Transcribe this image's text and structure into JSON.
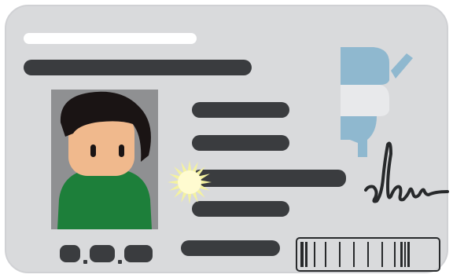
{
  "image": {
    "subject": "id-card-illustration"
  },
  "colors": {
    "card": "#d9dadc",
    "card_border": "#d0d1d4",
    "white_bar": "#ffffff",
    "dark_bar": "#3a3c3f",
    "photo_bg": "#8f9092",
    "hair": "#1a1414",
    "skin": "#f0b98d",
    "eye": "#1a1414",
    "shirt": "#1d7f3a",
    "seal": "#f4f2a0",
    "seal_core": "#fffbd0",
    "emblem_blue": "#8fb8cf",
    "emblem_light": "#e8e9eb",
    "signature": "#27292b",
    "barcode": "#27292b"
  },
  "icons": {
    "photo": "person-portrait-icon",
    "seal": "sun-seal-icon",
    "emblem": "emblem-icon",
    "signature": "signature-icon",
    "barcode": "barcode-icon"
  }
}
